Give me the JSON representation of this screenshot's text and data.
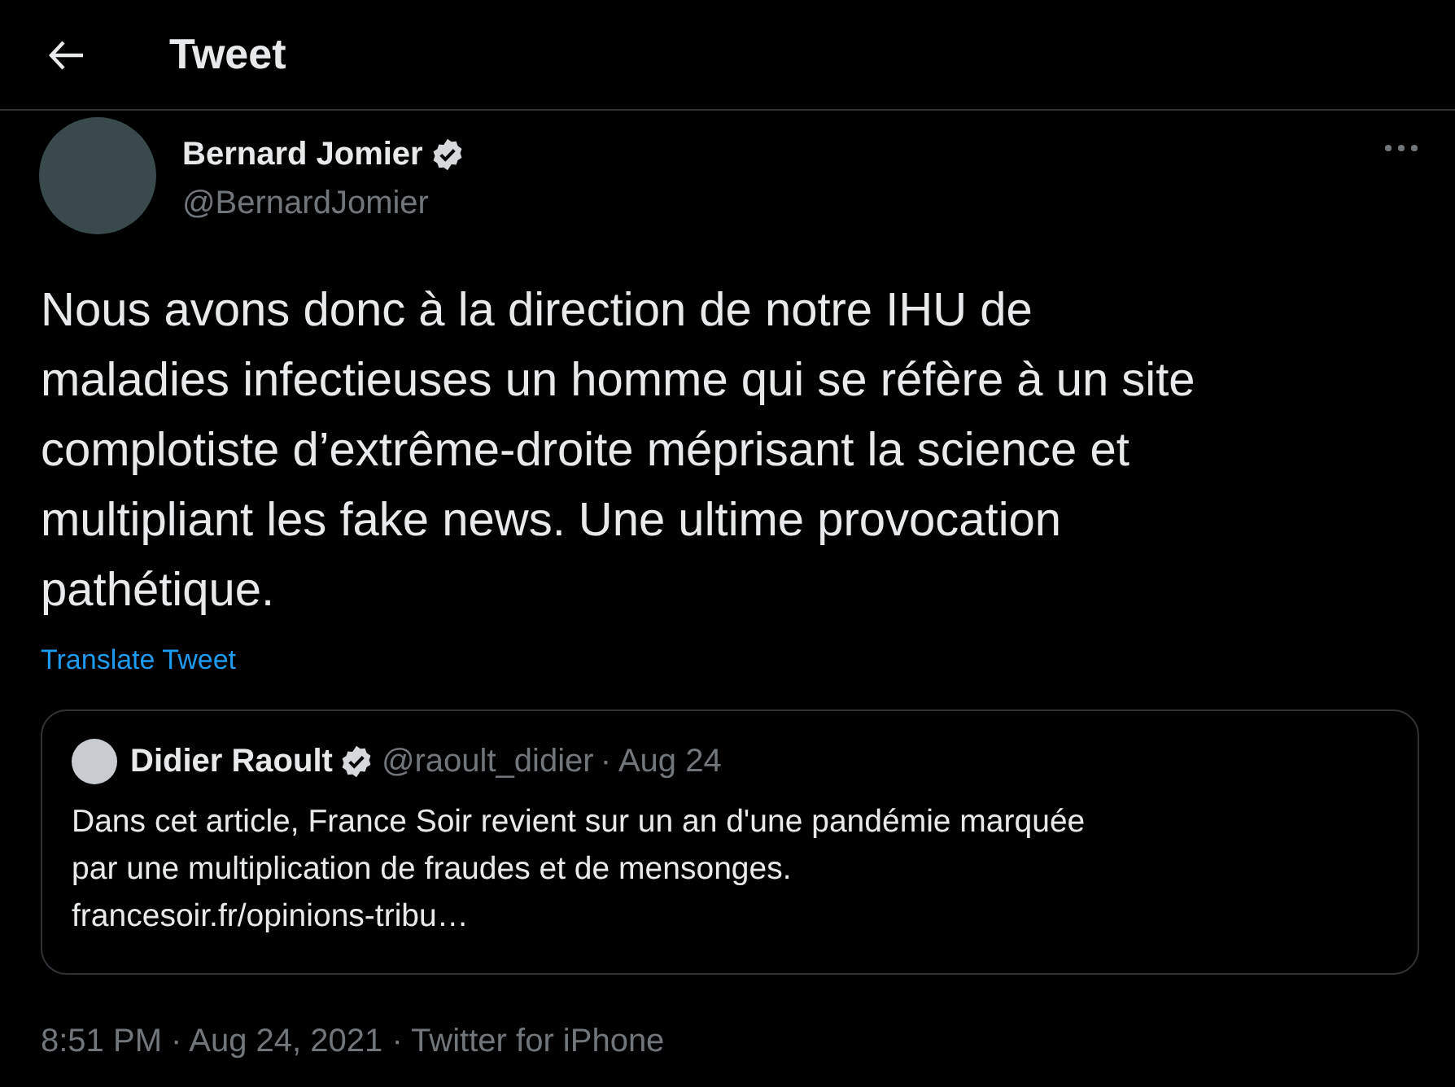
{
  "header": {
    "title": "Tweet"
  },
  "tweet": {
    "author": {
      "name": "Bernard Jomier",
      "handle": "@BernardJomier",
      "verified": true
    },
    "text": "Nous avons donc à la direction de notre IHU de\nmaladies infectieuses un homme qui se réfère à un site\ncomplotiste d’extrême-droite méprisant la science et\nmultipliant les fake news. Une ultime provocation\npathétique.",
    "translate": "Translate Tweet",
    "quote": {
      "author": {
        "name": "Didier Raoult",
        "handle": "@raoult_didier",
        "verified": true
      },
      "date": "· Aug 24",
      "text": "Dans cet article, France Soir revient sur un an d'une pandémie marquée\npar une multiplication de fraudes et de mensonges.\nfrancesoir.fr/opinions-tribu…"
    },
    "meta": "8:51 PM · Aug 24, 2021 · Twitter for iPhone"
  }
}
